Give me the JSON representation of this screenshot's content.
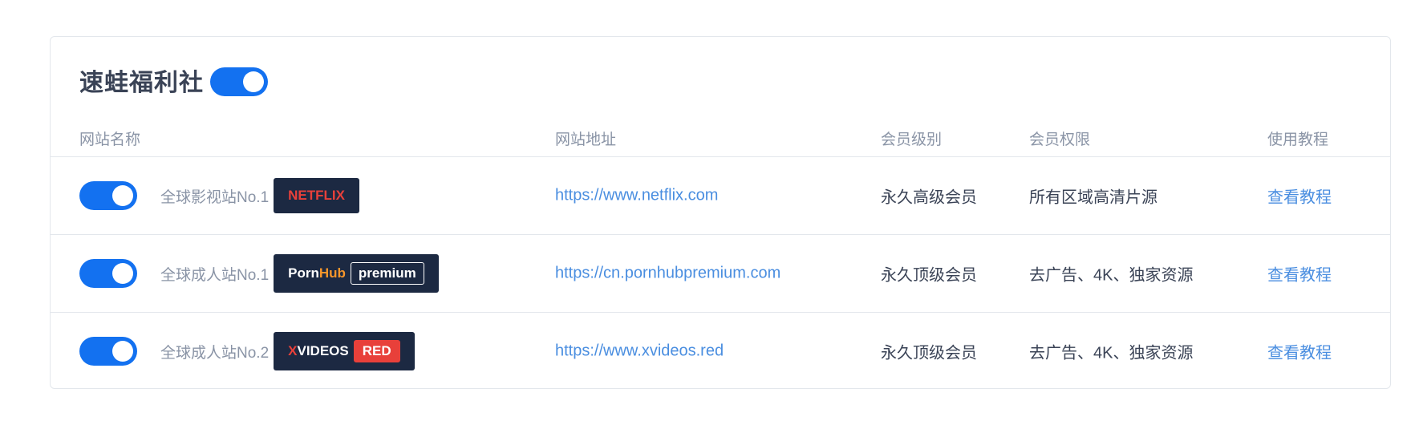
{
  "card": {
    "title": "速蛙福利社",
    "title_toggle_on": true
  },
  "columns": {
    "site_name": "网站名称",
    "site_url": "网站地址",
    "member_level": "会员级别",
    "member_rights": "会员权限",
    "tutorial": "使用教程"
  },
  "rows": [
    {
      "enabled": true,
      "desc": "全球影视站No.1",
      "badge": {
        "part1": "NETFLIX"
      },
      "url": "https://www.netflix.com",
      "level": "永久高级会员",
      "rights": "所有区域高清片源",
      "tutorial": "查看教程"
    },
    {
      "enabled": true,
      "desc": "全球成人站No.1",
      "badge": {
        "part1": "Porn",
        "part2": "Hub",
        "part3": "premium"
      },
      "url": "https://cn.pornhubpremium.com",
      "level": "永久顶级会员",
      "rights": "去广告、4K、独家资源",
      "tutorial": "查看教程"
    },
    {
      "enabled": true,
      "desc": "全球成人站No.2",
      "badge": {
        "part1": "X",
        "part2": "VIDEOS",
        "part3": "RED"
      },
      "url": "https://www.xvideos.red",
      "level": "永久顶级会员",
      "rights": "去广告、4K、独家资源",
      "tutorial": "查看教程"
    }
  ],
  "colors": {
    "accent": "#1371f0",
    "link": "#4a8ee0",
    "badge_bg": "#1c2942",
    "netflix_red": "#e8403a",
    "pornhub_orange": "#f7962b"
  }
}
